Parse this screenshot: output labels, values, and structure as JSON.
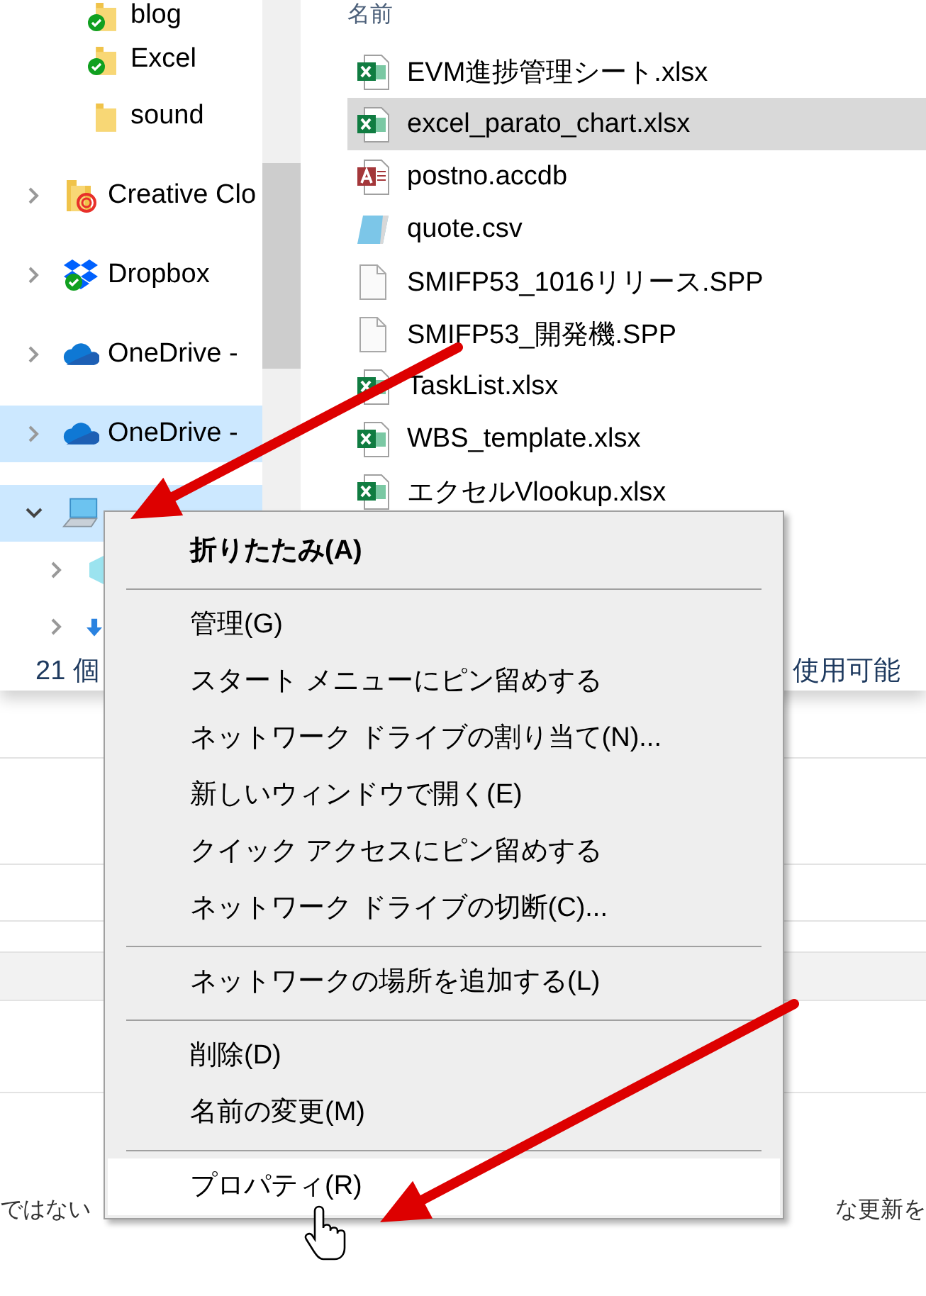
{
  "explorer": {
    "nav": {
      "items": [
        {
          "children": [
            {
              "label": "blog",
              "kind": "folder",
              "synced": true,
              "selected": false
            },
            {
              "label": "Excel",
              "kind": "folder",
              "synced": true,
              "selected": false
            },
            {
              "label": "sound",
              "kind": "folder",
              "synced": false,
              "selected": false
            }
          ]
        },
        {
          "label": "Creative Clo",
          "kind": "creative-cloud",
          "synced": false,
          "selected": false,
          "expanded": false
        },
        {
          "label": "Dropbox",
          "kind": "dropbox",
          "synced": true,
          "selected": false,
          "expanded": false
        },
        {
          "label": "OneDrive -",
          "kind": "onedrive",
          "synced": false,
          "selected": false,
          "expanded": false
        },
        {
          "label": "OneDrive -",
          "kind": "onedrive",
          "synced": false,
          "selected": true,
          "expanded": false
        },
        {
          "kind": "pc",
          "synced": false,
          "selected": true,
          "expanded": true,
          "children": [
            {
              "kind": "cube",
              "synced": false,
              "selected": false,
              "expanded": false
            },
            {
              "kind": "download",
              "synced": false,
              "selected": false,
              "expanded": false
            }
          ]
        }
      ]
    },
    "files": {
      "header": "名前",
      "rows": [
        {
          "name": "EVM進捗管理シート.xlsx",
          "kind": "excel",
          "selected": false
        },
        {
          "name": "excel_parato_chart.xlsx",
          "kind": "excel",
          "selected": true
        },
        {
          "name": "postno.accdb",
          "kind": "access",
          "selected": false
        },
        {
          "name": "quote.csv",
          "kind": "notepad",
          "selected": false
        },
        {
          "name": "SMIFP53_1016リリース.SPP",
          "kind": "blank",
          "selected": false
        },
        {
          "name": "SMIFP53_開発機.SPP",
          "kind": "blank",
          "selected": false
        },
        {
          "name": "TaskList.xlsx",
          "kind": "excel",
          "selected": false
        },
        {
          "name": "WBS_template.xlsx",
          "kind": "excel",
          "selected": false
        },
        {
          "name": "エクセルVlookup.xlsx",
          "kind": "excel",
          "selected": false
        }
      ]
    },
    "status_bar": {
      "item_count": "21 個",
      "free_space": "使用可能"
    }
  },
  "context_menu": {
    "items": [
      {
        "kind": "item",
        "label": "折りたたみ(A)",
        "default": true,
        "hovered": false
      },
      {
        "kind": "separator"
      },
      {
        "kind": "item",
        "label": "管理(G)",
        "default": false,
        "hovered": false
      },
      {
        "kind": "item",
        "label": "スタート メニューにピン留めする",
        "default": false,
        "hovered": false
      },
      {
        "kind": "item",
        "label": "ネットワーク ドライブの割り当て(N)...",
        "default": false,
        "hovered": false
      },
      {
        "kind": "item",
        "label": "新しいウィンドウで開く(E)",
        "default": false,
        "hovered": false
      },
      {
        "kind": "item",
        "label": "クイック アクセスにピン留めする",
        "default": false,
        "hovered": false
      },
      {
        "kind": "item",
        "label": "ネットワーク ドライブの切断(C)...",
        "default": false,
        "hovered": false
      },
      {
        "kind": "separator"
      },
      {
        "kind": "item",
        "label": "ネットワークの場所を追加する(L)",
        "default": false,
        "hovered": false
      },
      {
        "kind": "separator"
      },
      {
        "kind": "item",
        "label": "削除(D)",
        "default": false,
        "hovered": false
      },
      {
        "kind": "item",
        "label": "名前の変更(M)",
        "default": false,
        "hovered": false
      },
      {
        "kind": "separator"
      },
      {
        "kind": "item",
        "label": "プロパティ(R)",
        "default": false,
        "hovered": true
      }
    ]
  },
  "article": {
    "text_left": "ではない",
    "text_right": "な更新を"
  }
}
